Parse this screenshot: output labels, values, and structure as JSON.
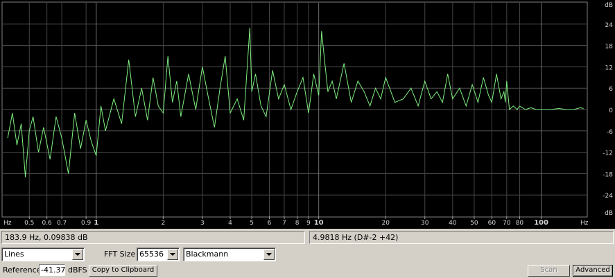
{
  "chart_data": {
    "type": "line",
    "x_scale": "log",
    "xlim": [
      0.38,
      160
    ],
    "ylim": [
      -30,
      30
    ],
    "y_unit": "dB",
    "x_unit": "Hz",
    "y_ticks": [
      "24",
      "18",
      "12",
      "6",
      "0",
      "-6",
      "-12",
      "-18",
      "-24"
    ],
    "y_tick_values": [
      24,
      18,
      12,
      6,
      0,
      -6,
      -12,
      -18,
      -24
    ],
    "y_top_label": "dB",
    "y_bottom_label": "dB",
    "x_ticks": [
      "0.5",
      "0.6",
      "0.7",
      "0.9",
      "1",
      "2",
      "3",
      "4",
      "5",
      "6",
      "7",
      "8",
      "9",
      "10",
      "20",
      "30",
      "40",
      "50",
      "60",
      "70",
      "80",
      "100"
    ],
    "x_tick_values": [
      0.5,
      0.6,
      0.7,
      0.9,
      1,
      2,
      3,
      4,
      5,
      6,
      7,
      8,
      9,
      10,
      20,
      30,
      40,
      50,
      60,
      70,
      80,
      100
    ],
    "x_major_values": [
      1,
      10,
      100
    ],
    "x_left_label": "Hz",
    "x_right_label": "Hz",
    "grid": true,
    "line_color": "#80f080",
    "series_x": [
      0.4,
      0.42,
      0.44,
      0.46,
      0.48,
      0.5,
      0.52,
      0.55,
      0.58,
      0.62,
      0.66,
      0.7,
      0.75,
      0.8,
      0.85,
      0.9,
      0.95,
      1.0,
      1.05,
      1.1,
      1.2,
      1.3,
      1.4,
      1.5,
      1.6,
      1.7,
      1.8,
      1.9,
      2.0,
      2.1,
      2.2,
      2.3,
      2.4,
      2.6,
      2.8,
      3.0,
      3.2,
      3.4,
      3.6,
      3.8,
      4.0,
      4.3,
      4.6,
      4.9,
      5.0,
      5.2,
      5.5,
      5.8,
      6.2,
      6.6,
      7.0,
      7.5,
      8.0,
      8.5,
      9.0,
      9.5,
      10.0,
      10.3,
      10.7,
      11.0,
      11.5,
      12,
      13,
      14,
      15,
      16,
      17,
      18,
      19,
      20,
      22,
      24,
      26,
      28,
      30,
      32,
      34,
      36,
      38,
      40,
      43,
      46,
      49,
      52,
      55,
      58,
      60,
      63,
      66,
      68,
      69,
      70,
      72,
      75,
      78,
      80,
      85,
      90,
      95,
      100,
      110,
      120,
      130,
      140,
      150,
      155
    ],
    "series_y": [
      -8,
      -1,
      -10,
      -4,
      -19,
      -6,
      -2,
      -12,
      -5,
      -14,
      -2,
      -8,
      -18,
      -1,
      -11,
      -3,
      -9,
      -13,
      1,
      -6,
      3,
      -4,
      14,
      -2,
      6,
      -3,
      9,
      1,
      -1,
      15,
      2,
      8,
      -2,
      10,
      0,
      12,
      3,
      -5,
      6,
      15,
      -1,
      3,
      -3,
      23,
      5,
      10,
      1,
      -2,
      11,
      3,
      7,
      0,
      5,
      9,
      -1,
      10,
      4,
      22,
      12,
      5,
      8,
      3,
      13,
      2,
      8,
      5,
      1,
      6,
      3,
      9,
      2,
      3,
      6,
      1,
      8,
      3,
      5,
      2,
      10,
      3,
      6,
      1,
      7,
      2,
      9,
      4,
      2,
      10,
      3,
      5,
      2,
      8,
      0,
      1,
      0,
      1,
      0,
      0.5,
      0,
      0,
      0,
      0.3,
      0,
      0,
      0.5,
      0.3,
      0
    ]
  },
  "status": {
    "cursor_readout": "183.9 Hz, 0.09838 dB",
    "peak_readout": "4.9818 Hz (D#-2 +42)"
  },
  "controls": {
    "display_mode": "Lines",
    "fft_size_label": "FFT Size",
    "fft_size": "65536",
    "window": "Blackmann",
    "reference_label": "Reference",
    "reference_value": "-41.37",
    "reference_unit": "dBFS",
    "copy_label": "Copy to Clipboard",
    "scan_label": "Scan",
    "advanced_label": "Advanced"
  }
}
